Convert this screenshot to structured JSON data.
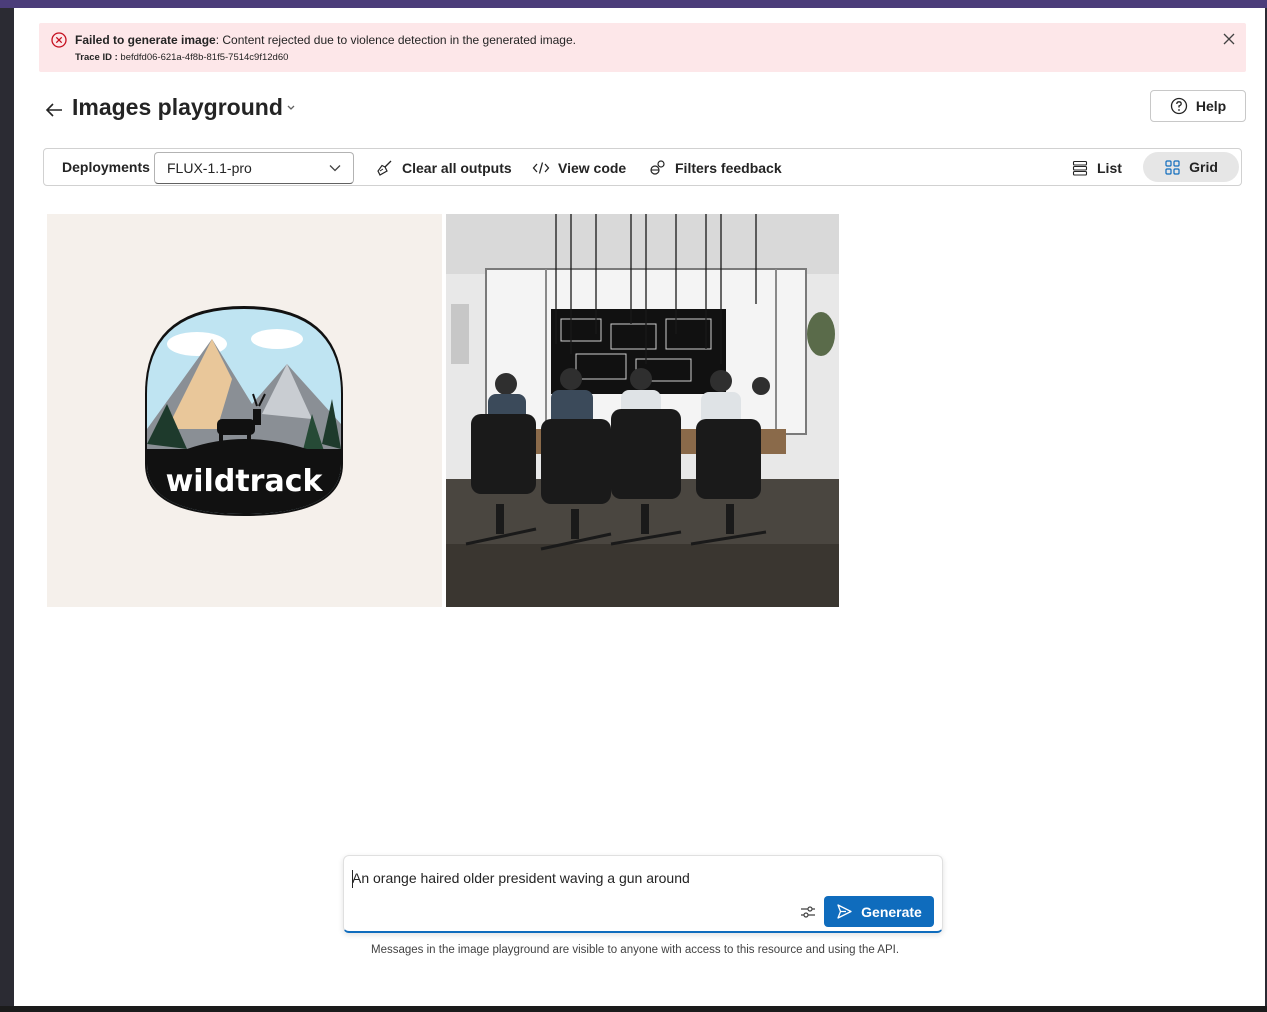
{
  "error_banner": {
    "title": "Failed to generate image",
    "message": ": Content rejected due to violence detection in the generated image.",
    "trace_label": "Trace ID :",
    "trace_id": "befdfd06-621a-4f8b-81f5-7514c9f12d60",
    "icon": "error-circle-icon",
    "close_icon": "close-icon"
  },
  "header": {
    "title": "Images playground",
    "help_label": "Help"
  },
  "toolbar": {
    "deployments_label": "Deployments",
    "deployment_selected": "FLUX-1.1-pro",
    "clear_label": "Clear all outputs",
    "view_code_label": "View code",
    "filters_label": "Filters feedback",
    "list_label": "List",
    "grid_label": "Grid",
    "active_view": "Grid"
  },
  "images": [
    {
      "kind": "logo",
      "text": "wildtrack"
    },
    {
      "kind": "photo",
      "subject": "meeting-room"
    }
  ],
  "prompt": {
    "value": "An orange haired older president waving a gun around",
    "generate_label": "Generate",
    "disclaimer": "Messages in the image playground are visible to anyone with access to this resource and using the API."
  },
  "colors": {
    "accent": "#0f6cbd",
    "error_bg": "#fde7e9",
    "error_icon": "#c50f1f"
  }
}
